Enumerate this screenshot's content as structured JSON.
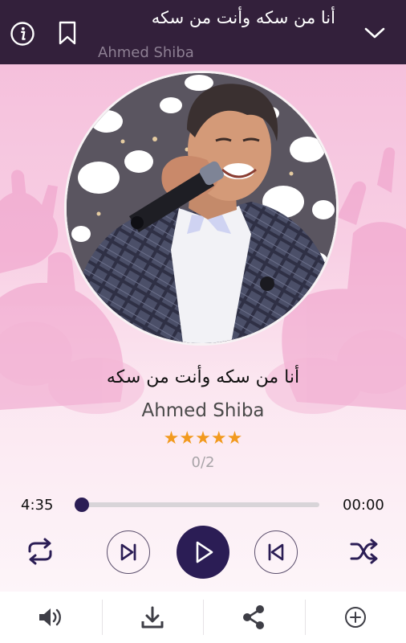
{
  "header": {
    "title": "أنا من سكه وأنت من سكه",
    "artist": "Ahmed Shiba",
    "icons": [
      "info-icon",
      "bookmark-icon",
      "chevron-down-icon"
    ]
  },
  "song": {
    "title": "أنا من سكه وأنت من سكه",
    "artist": "Ahmed Shiba",
    "rating_stars": 5,
    "rating_max": 5,
    "rating_count": "0/2"
  },
  "player": {
    "elapsed": "4:35",
    "remaining": "00:00",
    "progress_fraction": 0.0,
    "controls": [
      "repeat-icon",
      "next-icon",
      "play-icon",
      "previous-icon",
      "shuffle-icon"
    ]
  },
  "toolbar": {
    "items": [
      "volume-icon",
      "download-icon",
      "share-icon",
      "add-circle-icon"
    ]
  },
  "colors": {
    "header_bg": "#33203b",
    "accent": "#2b1d55",
    "star": "#f29a1f",
    "background_pink": "#f5c0dc"
  }
}
